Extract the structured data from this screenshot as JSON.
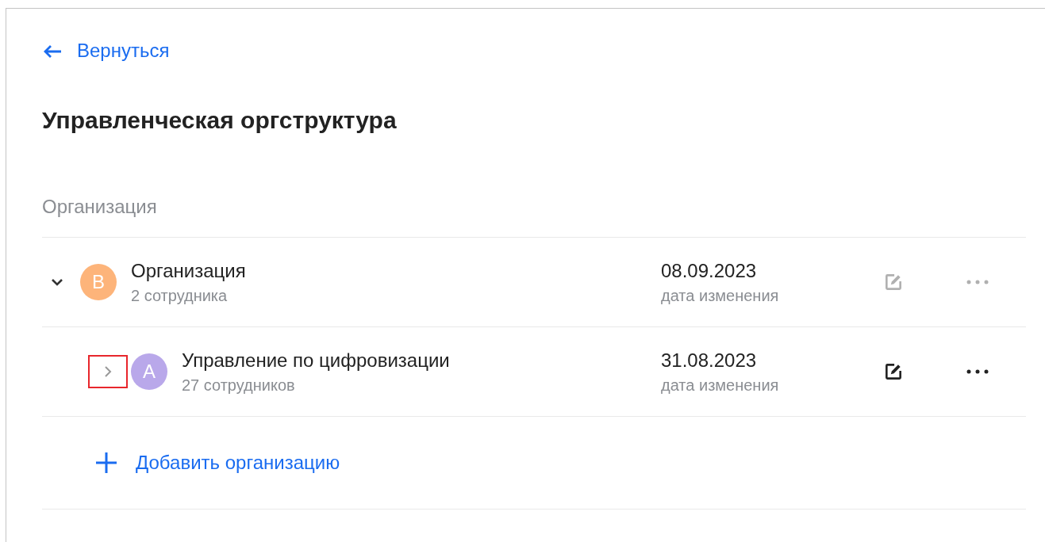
{
  "back_link": {
    "label": "Вернуться"
  },
  "title": "Управленческая оргструктура",
  "section_label": "Организация",
  "tree": [
    {
      "name": "Организация",
      "count": "2 сотрудника",
      "initial": "В",
      "color": "#fdb47a",
      "date": "08.09.2023",
      "date_caption": "дата изменения",
      "expanded": true,
      "highlighted": false,
      "actions_disabled": true,
      "children": [
        {
          "name": "Управление по цифровизации",
          "count": "27 сотрудников",
          "initial": "А",
          "color": "#b9a8ea",
          "date": "31.08.2023",
          "date_caption": "дата изменения",
          "expanded": false,
          "highlighted": true,
          "actions_disabled": false
        }
      ]
    }
  ],
  "add_button": {
    "label": "Добавить организацию"
  }
}
